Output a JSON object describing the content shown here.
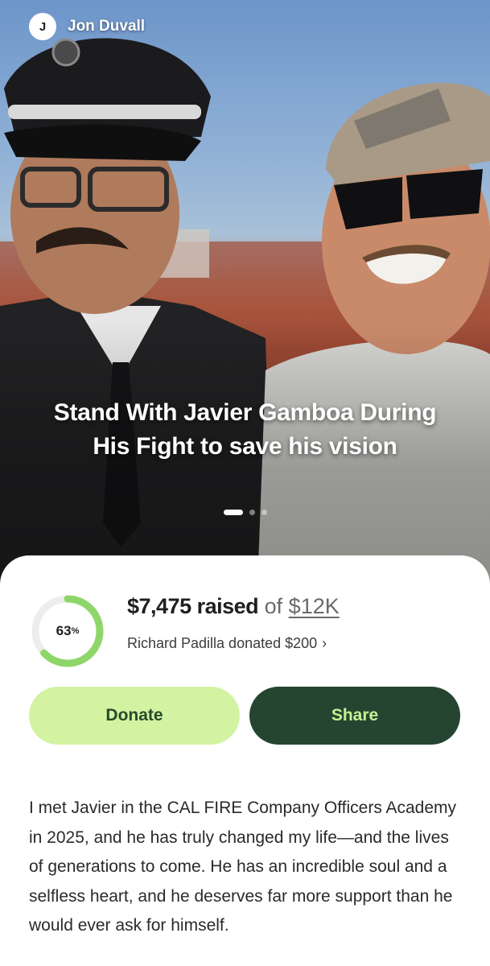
{
  "author": {
    "initial": "J",
    "name": "Jon Duvall"
  },
  "hero": {
    "title": "Stand With Javier Gamboa During His Fight to save his vision",
    "slides_total": 3,
    "active_slide": 1
  },
  "progress": {
    "percent_label": "63",
    "percent_suffix": "%",
    "fraction": 0.63,
    "raised_amount": "$7,475 raised",
    "of_text": " of ",
    "goal": "$12K",
    "recent_donation": "Richard Padilla donated $200",
    "chevron": "›"
  },
  "buttons": {
    "donate": "Donate",
    "share": "Share"
  },
  "story": "I met Javier in the CAL FIRE Company Officers Academy in 2025, and he has truly changed my life—and the lives of generations to come. He has an incredible soul and a selfless heart, and he deserves far more support than he would ever ask for himself.",
  "colors": {
    "ring_fill": "#8fd66a",
    "ring_track": "#ededed",
    "donate_bg": "#d3f3a3",
    "share_bg": "#264530"
  }
}
